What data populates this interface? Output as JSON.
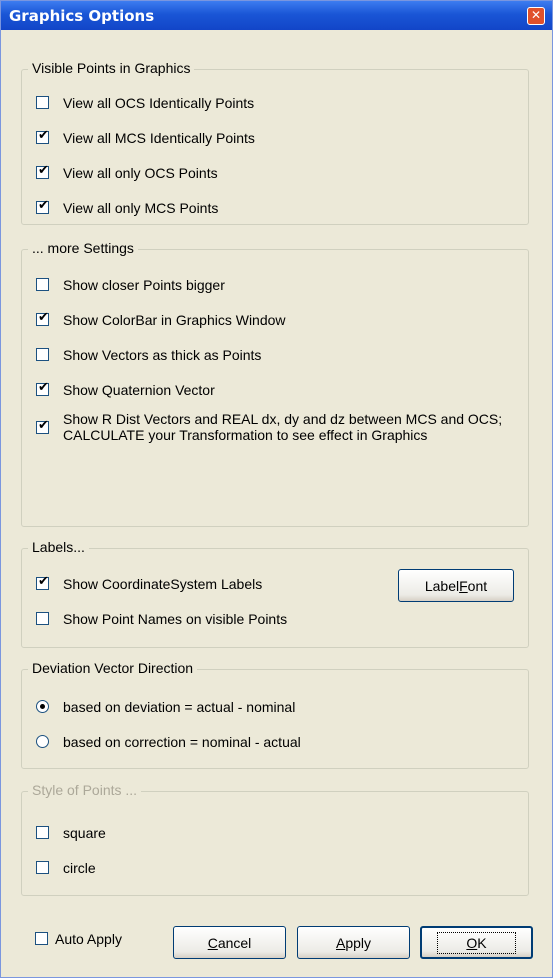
{
  "window": {
    "title": "Graphics Options",
    "close_glyph": "✕"
  },
  "visible_points": {
    "legend": "Visible Points in Graphics",
    "items": [
      {
        "label": "View all OCS Identically Points",
        "checked": false
      },
      {
        "label": "View all MCS Identically Points",
        "checked": true
      },
      {
        "label": "View all only OCS Points",
        "checked": true
      },
      {
        "label": "View all only MCS Points",
        "checked": true
      }
    ]
  },
  "more_settings": {
    "legend": "... more Settings",
    "items": [
      {
        "label": "Show closer Points bigger",
        "checked": false
      },
      {
        "label": "Show ColorBar in Graphics Window",
        "checked": true
      },
      {
        "label": "Show Vectors as thick as Points",
        "checked": false
      },
      {
        "label": "Show Quaternion Vector",
        "checked": true
      },
      {
        "label": "Show R Dist Vectors and REAL dx, dy and dz between MCS and OCS; CALCULATE your Transformation to see effect in Graphics",
        "checked": true
      }
    ]
  },
  "labels": {
    "legend": "Labels...",
    "items": [
      {
        "label": "Show CoordinateSystem Labels",
        "checked": true
      },
      {
        "label": "Show Point Names on visible Points",
        "checked": false
      }
    ],
    "font_button_pre": "Label ",
    "font_button_mnemonic": "F",
    "font_button_post": "ont"
  },
  "deviation": {
    "legend": "Deviation Vector Direction",
    "options": [
      {
        "label": "based on deviation = actual - nominal",
        "selected": true
      },
      {
        "label": "based on correction = nominal - actual",
        "selected": false
      }
    ]
  },
  "style": {
    "legend": "Style of Points ...",
    "items": [
      {
        "label": "square",
        "checked": false
      },
      {
        "label": "circle",
        "checked": false
      }
    ]
  },
  "footer": {
    "auto_apply": {
      "label": "Auto Apply",
      "checked": false
    },
    "cancel": {
      "mnemonic": "C",
      "rest": "ancel"
    },
    "apply": {
      "mnemonic": "A",
      "rest": "pply"
    },
    "ok": {
      "mnemonic": "O",
      "rest": "K"
    }
  },
  "check_glyph": "✔"
}
